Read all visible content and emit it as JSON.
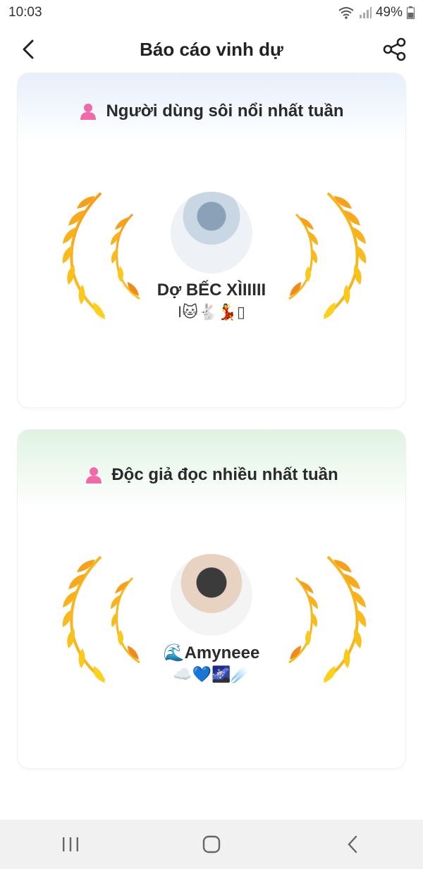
{
  "status_bar": {
    "time": "10:03",
    "battery": "49%"
  },
  "header": {
    "title": "Báo cáo vinh dự"
  },
  "cards": [
    {
      "title": "Người dùng sôi nổi nhất tuần",
      "user_name": "Dợ BẾC XÌIIIII",
      "user_emoji": "I🐱🐇💃▯"
    },
    {
      "title": "Độc giả đọc nhiều nhất tuần",
      "user_name": "🌊Amyneee",
      "user_emoji": "☁️💙🌌☄️"
    }
  ],
  "colors": {
    "accent_pink": "#f06aa8",
    "wreath_gold": "#f7b51e",
    "wreath_orange": "#f08a1c"
  },
  "icons": {
    "back": "chevron-left-icon",
    "share": "share-icon",
    "user": "user-icon",
    "nav_recent": "recent-apps-icon",
    "nav_home": "home-icon",
    "nav_back": "nav-back-icon"
  }
}
